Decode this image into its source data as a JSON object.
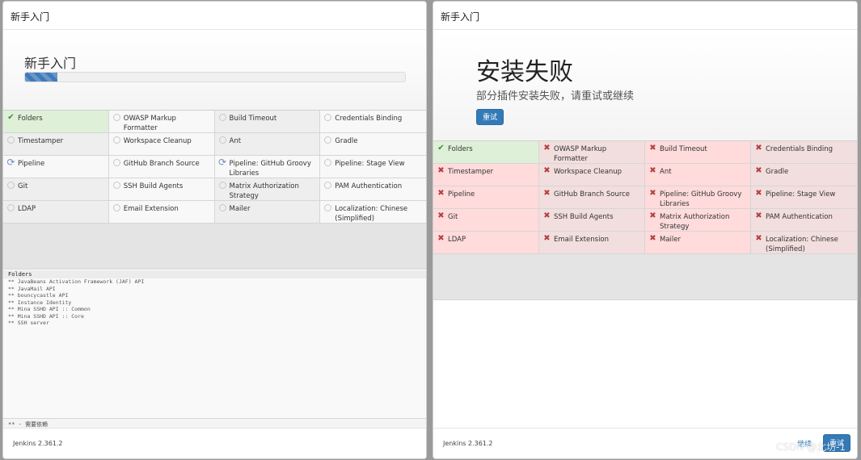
{
  "left_panel": {
    "window_title": "新手入门",
    "title": "新手入门",
    "progress": 0.085,
    "plugins": [
      {
        "name": "Folders",
        "status": "success"
      },
      {
        "name": "OWASP Markup Formatter",
        "status": "pending"
      },
      {
        "name": "Build Timeout",
        "status": "pending"
      },
      {
        "name": "Credentials Binding",
        "status": "pending"
      },
      {
        "name": "Timestamper",
        "status": "pending"
      },
      {
        "name": "Workspace Cleanup",
        "status": "pending"
      },
      {
        "name": "Ant",
        "status": "pending"
      },
      {
        "name": "Gradle",
        "status": "pending"
      },
      {
        "name": "Pipeline",
        "status": "installing"
      },
      {
        "name": "GitHub Branch Source",
        "status": "pending"
      },
      {
        "name": "Pipeline: GitHub Groovy Libraries",
        "status": "installing"
      },
      {
        "name": "Pipeline: Stage View",
        "status": "pending"
      },
      {
        "name": "Git",
        "status": "pending"
      },
      {
        "name": "SSH Build Agents",
        "status": "pending"
      },
      {
        "name": "Matrix Authorization Strategy",
        "status": "pending"
      },
      {
        "name": "PAM Authentication",
        "status": "pending"
      },
      {
        "name": "LDAP",
        "status": "pending"
      },
      {
        "name": "Email Extension",
        "status": "pending"
      },
      {
        "name": "Mailer",
        "status": "pending"
      },
      {
        "name": "Localization: Chinese (Simplified)",
        "status": "pending"
      }
    ],
    "log": {
      "header": "Folders",
      "lines": [
        "** JavaBeans Activation Framework (JAF) API",
        "** JavaMail API",
        "** bouncycastle API",
        "** Instance Identity",
        "** Mina SSHD API :: Common",
        "** Mina SSHD API :: Core",
        "** SSH server"
      ],
      "legend": "** - 需要依赖"
    },
    "version": "Jenkins 2.361.2"
  },
  "right_panel": {
    "window_title": "新手入门",
    "title": "安装失败",
    "subtitle": "部分插件安装失败，请重试或继续",
    "retry_label": "重试",
    "plugins": [
      {
        "name": "Folders",
        "status": "success"
      },
      {
        "name": "OWASP Markup Formatter",
        "status": "failed"
      },
      {
        "name": "Build Timeout",
        "status": "failed"
      },
      {
        "name": "Credentials Binding",
        "status": "failed"
      },
      {
        "name": "Timestamper",
        "status": "failed"
      },
      {
        "name": "Workspace Cleanup",
        "status": "failed"
      },
      {
        "name": "Ant",
        "status": "failed"
      },
      {
        "name": "Gradle",
        "status": "failed"
      },
      {
        "name": "Pipeline",
        "status": "failed"
      },
      {
        "name": "GitHub Branch Source",
        "status": "failed"
      },
      {
        "name": "Pipeline: GitHub Groovy Libraries",
        "status": "failed"
      },
      {
        "name": "Pipeline: Stage View",
        "status": "failed"
      },
      {
        "name": "Git",
        "status": "failed"
      },
      {
        "name": "SSH Build Agents",
        "status": "failed"
      },
      {
        "name": "Matrix Authorization Strategy",
        "status": "failed"
      },
      {
        "name": "PAM Authentication",
        "status": "failed"
      },
      {
        "name": "LDAP",
        "status": "failed"
      },
      {
        "name": "Email Extension",
        "status": "failed"
      },
      {
        "name": "Mailer",
        "status": "failed"
      },
      {
        "name": "Localization: Chinese (Simplified)",
        "status": "failed"
      }
    ],
    "version": "Jenkins 2.361.2",
    "footer_continue_label": "继续",
    "footer_retry_label": "重试"
  },
  "watermark": "CSDN @北坊-1",
  "icons": {
    "success": "check-icon",
    "pending": "circle-icon",
    "installing": "refresh-icon",
    "failed": "cross-icon"
  },
  "colors": {
    "primary": "#337ab7",
    "success_bg": "#dff0d8",
    "failed_bg": "#f2dede",
    "failed_icon": "#b44040"
  }
}
